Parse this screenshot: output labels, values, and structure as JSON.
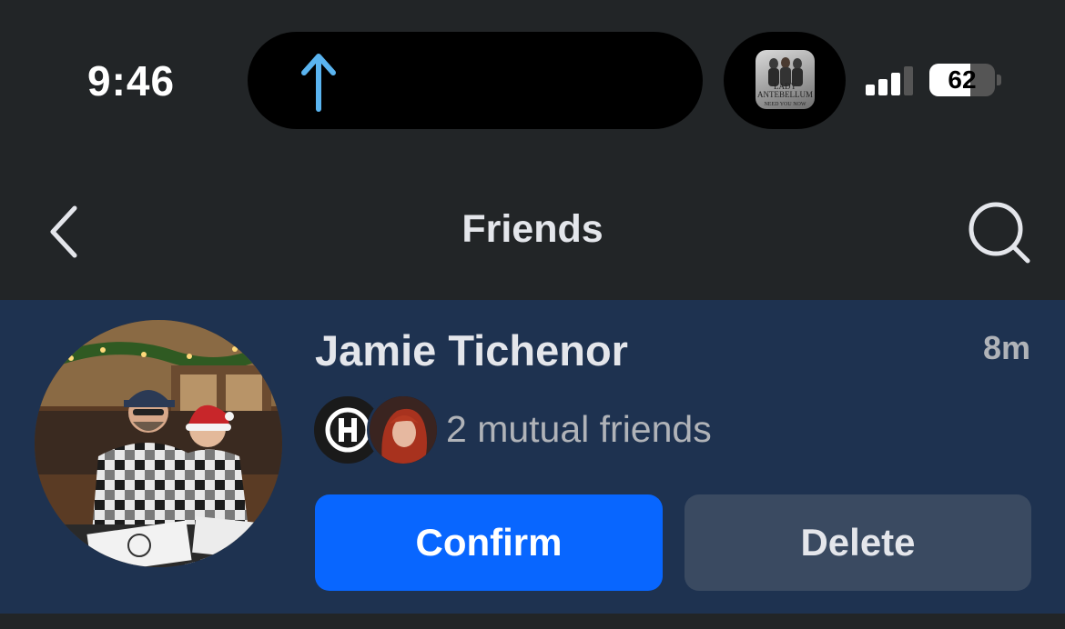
{
  "status_bar": {
    "time": "9:46",
    "battery_percent": 62,
    "battery_label": "62",
    "signal_bars_active": 3,
    "signal_bars_total": 4,
    "island_icon": "upload-arrow-icon",
    "island_icon_color": "#5ab4f0",
    "album_art_text": "LADY ANTEBELLUM",
    "album_art_subtext": "NEED YOU NOW"
  },
  "nav": {
    "title": "Friends",
    "back_icon": "chevron-left-icon",
    "search_icon": "search-icon"
  },
  "friend_request": {
    "name": "Jamie Tichenor",
    "time_ago": "8m",
    "mutual_friends_text": "2 mutual friends",
    "mutual_avatar_1_letter": "H",
    "confirm_label": "Confirm",
    "delete_label": "Delete"
  },
  "colors": {
    "background": "#222527",
    "card_background": "#1e3250",
    "confirm": "#0866ff",
    "delete": "#3a4a61"
  }
}
